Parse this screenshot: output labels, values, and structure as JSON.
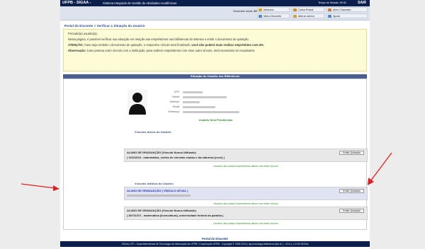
{
  "header": {
    "brand": "UFPB - SIGAA -",
    "subtitle": "Sistema Integrado de Gestão de Atividades Acadêmicas",
    "session_timer": "Tempo de Sessão: 59:30",
    "logout": "SAIR"
  },
  "infobar": {
    "semester_label": "Semestre atual:",
    "semester_value": "2015.2",
    "quick_links": [
      {
        "label": "Módulos",
        "color": "#e0a020"
      },
      {
        "label": "Caixa Postal",
        "color": "#d48a2a"
      },
      {
        "label": "Abrir Chamado",
        "color": "#d47a2a"
      },
      {
        "label": "Menu Discente",
        "color": "#4a8ad4"
      },
      {
        "label": "Alterar senha",
        "color": "#d0a040"
      },
      {
        "label": "Ajuda",
        "color": "#4a8ad4"
      }
    ]
  },
  "breadcrumb": "Portal do Discente > Verificar a Situação do Usuário",
  "notice": {
    "greeting": "Prezado(a) usuário(a),",
    "line1": "Nesta página, é possível verificar sua situação em relação aos empréstimos nas bibliotecas do sistema e emitir o documento de quitação.",
    "attention_label": "ATENÇÃO:",
    "attention_text": "Caso seja emitido o documento de quitação, o respectivo vínculo será finalizado,",
    "attention_bold": "você não poderá mais realizar empréstimo com ele.",
    "obs_label": "Observação:",
    "obs_text": "Caso possua outro vínculo com a instituição, para realizar empréstimos com esse outro vínculo, será necessário se recadastrar."
  },
  "user_section": {
    "title": "Situação do Usuário nas Bibliotecas",
    "fields": [
      "CPF:",
      "Nome:",
      "Telefone:",
      "Email:",
      "Endereço:"
    ],
    "status": "Usuário Sem Pendências"
  },
  "active_links": {
    "title": "Vínculos Ativos do Usuário",
    "entries": [
      {
        "line1": "ALUNO DE GRADUAÇÃO (Vínculo Nunca Utilizado)",
        "line2": "( 11011018 - matematica, centro de ciencias exatas e da natureza (ccen) )",
        "button": "Emitir Quitação",
        "no_loans": "Usuário não possui empréstimos ativos com esse vínculo"
      }
    ]
  },
  "inactive_links": {
    "title": "Vínculos Inativos do Usuário",
    "entries": [
      {
        "line1": "ALUNO DE GRADUAÇÃO ( VÍNCULO ATUAL )",
        "button": "Emitir Quitação",
        "no_loans": "Usuário não possui empréstimos ativos com esse vínculo"
      },
      {
        "line1": "ALUNO DE GRADUAÇÃO (Vínculo Nunca Utilizado)",
        "line2": "( 80731072 - matematica (licenciatura), universidade federal da paraiba )",
        "button": "Emitir Quitação",
        "no_loans": "Usuário não possui empréstimos ativos com esse vínculo"
      }
    ]
  },
  "footer_nav": "Portal do Discente",
  "footer": "SIGAA | STI - Superintendência de Tecnologia da Informação da UFPB / Cooperação UFRN - Copyright © 2006-2016 | sig-homologa.biblioteca.ufpb.br | - v3.6.4_2.6.39 4922hs"
}
